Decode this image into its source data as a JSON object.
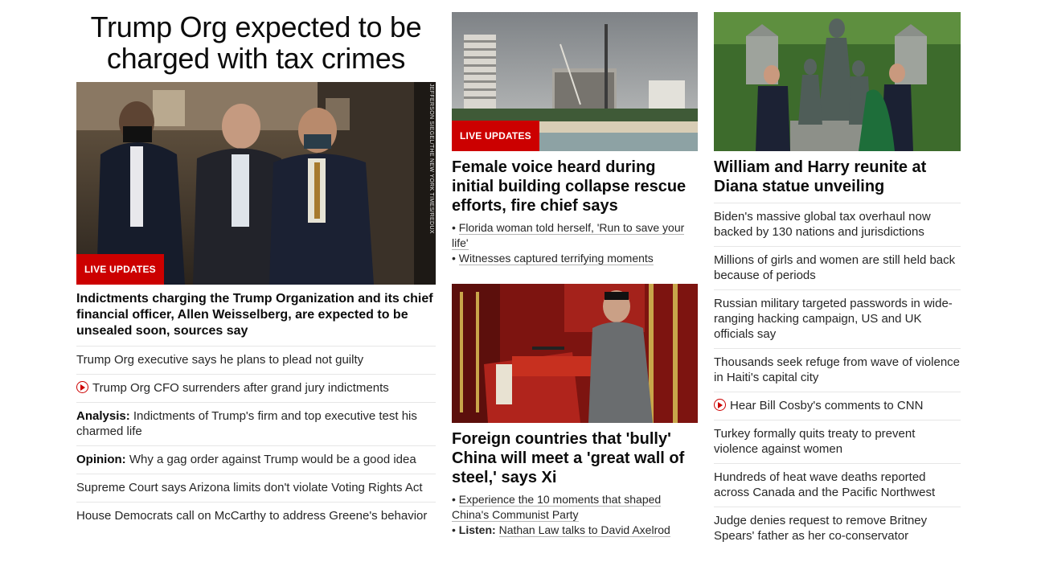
{
  "left": {
    "headline": "Trump Org expected to be charged with tax crimes",
    "badge": "LIVE UPDATES",
    "photo_credit": "JEFFERSON SIEGEL/THE NEW YORK TIMES/REDUX",
    "lead": "Indictments charging the Trump Organization and its chief financial officer, Allen Weisselberg, are expected to be unsealed soon, sources say",
    "items": [
      {
        "prefix": "",
        "text": "Trump Org executive says he plans to plead not guilty",
        "video": false
      },
      {
        "prefix": "",
        "text": "Trump Org CFO surrenders after grand jury indictments",
        "video": true
      },
      {
        "prefix": "Analysis:",
        "text": " Indictments of Trump's firm and top executive test his charmed life",
        "video": false
      },
      {
        "prefix": "Opinion:",
        "text": " Why a gag order against Trump would be a good idea",
        "video": false
      },
      {
        "prefix": "",
        "text": "Supreme Court says Arizona limits don't violate Voting Rights Act",
        "video": false
      },
      {
        "prefix": "",
        "text": "House Democrats call on McCarthy to address Greene's behavior",
        "video": false
      }
    ]
  },
  "middle": {
    "story1": {
      "badge": "LIVE UPDATES",
      "title": "Female voice heard during initial building collapse rescue efforts, fire chief says",
      "links": [
        {
          "prefix": "",
          "text": "Florida woman told herself, 'Run to save your life'"
        },
        {
          "prefix": "",
          "text": "Witnesses captured terrifying moments"
        }
      ]
    },
    "story2": {
      "title": "Foreign countries that 'bully' China will meet a 'great wall of steel,' says Xi",
      "links": [
        {
          "prefix": "",
          "text": "Experience the 10 moments that shaped China's Communist Party"
        },
        {
          "prefix": "Listen:",
          "text": "Nathan Law talks to David Axelrod"
        }
      ]
    }
  },
  "right": {
    "title": "William and Harry reunite at Diana statue unveiling",
    "items": [
      {
        "text": "Biden's massive global tax overhaul now backed by 130 nations and jurisdictions",
        "video": false
      },
      {
        "text": "Millions of girls and women are still held back because of periods",
        "video": false
      },
      {
        "text": "Russian military targeted passwords in wide-ranging hacking campaign, US and UK officials say",
        "video": false
      },
      {
        "text": "Thousands seek refuge from wave of violence in Haiti's capital city",
        "video": false
      },
      {
        "text": "Hear Bill Cosby's comments to CNN",
        "video": true
      },
      {
        "text": "Turkey formally quits treaty to prevent violence against women",
        "video": false
      },
      {
        "text": "Hundreds of heat wave deaths reported across Canada and the Pacific Northwest",
        "video": false
      },
      {
        "text": "Judge denies request to remove Britney Spears' father as her co-conservator",
        "video": false
      }
    ]
  },
  "colors": {
    "accent": "#cc0000",
    "text": "#0c0c0c",
    "divider": "#e6e6e6"
  },
  "icons": {
    "video": "play-circle-icon"
  }
}
